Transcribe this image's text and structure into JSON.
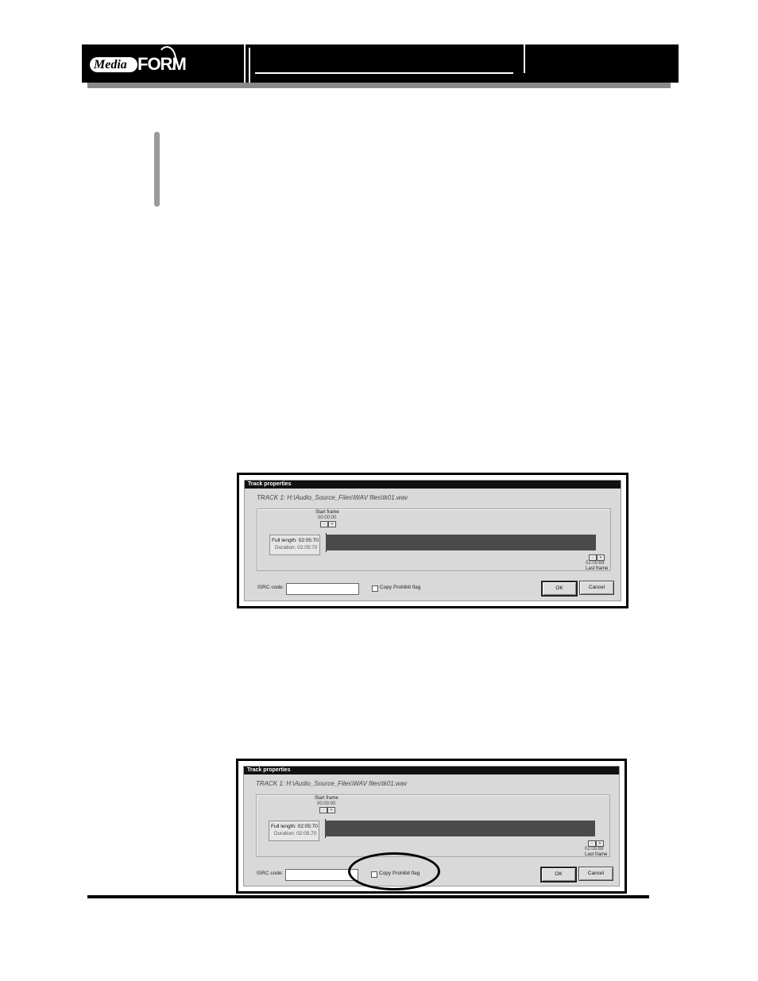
{
  "header": {
    "logo_media": "Media",
    "logo_form": "FORM"
  },
  "dialogs": [
    {
      "title": "Track properties",
      "track_path": "TRACK 1: H:\\Audio_Source_Files\\WAV files\\tk01.wav",
      "start_frame_label": "Start frame",
      "start_frame_time": "00:00:00",
      "full_length": "Full length: 02:05:70",
      "duration": "Duration: 02:05:70",
      "last_frame_time": "02:05:69",
      "last_frame_label": "Last frame",
      "isrc_label": "ISRC code:",
      "isrc_value": "",
      "copy_prohibit_label": "Copy Prohibit flag",
      "copy_prohibit_checked": false,
      "ok_label": "OK",
      "cancel_label": "Cancel",
      "step_minus": "-",
      "step_plus": "+"
    },
    {
      "title": "Track properties",
      "track_path": "TRACK 1: H:\\Audio_Source_Files\\WAV files\\tk01.wav",
      "start_frame_label": "Start frame",
      "start_frame_time": "00:00:00",
      "full_length": "Full length: 02:05:70",
      "duration": "Duration: 02:05:70",
      "last_frame_time": "02:05:69",
      "last_frame_label": "Last frame",
      "isrc_label": "ISRC code:",
      "isrc_value": "",
      "copy_prohibit_label": "Copy Prohibit flag",
      "copy_prohibit_checked": false,
      "ok_label": "OK",
      "cancel_label": "Cancel",
      "step_minus": "-",
      "step_plus": "+"
    }
  ],
  "colors": {
    "banner": "#000000",
    "dialog_bg": "#d9d9d9",
    "track_bar": "#4a4a4a"
  }
}
